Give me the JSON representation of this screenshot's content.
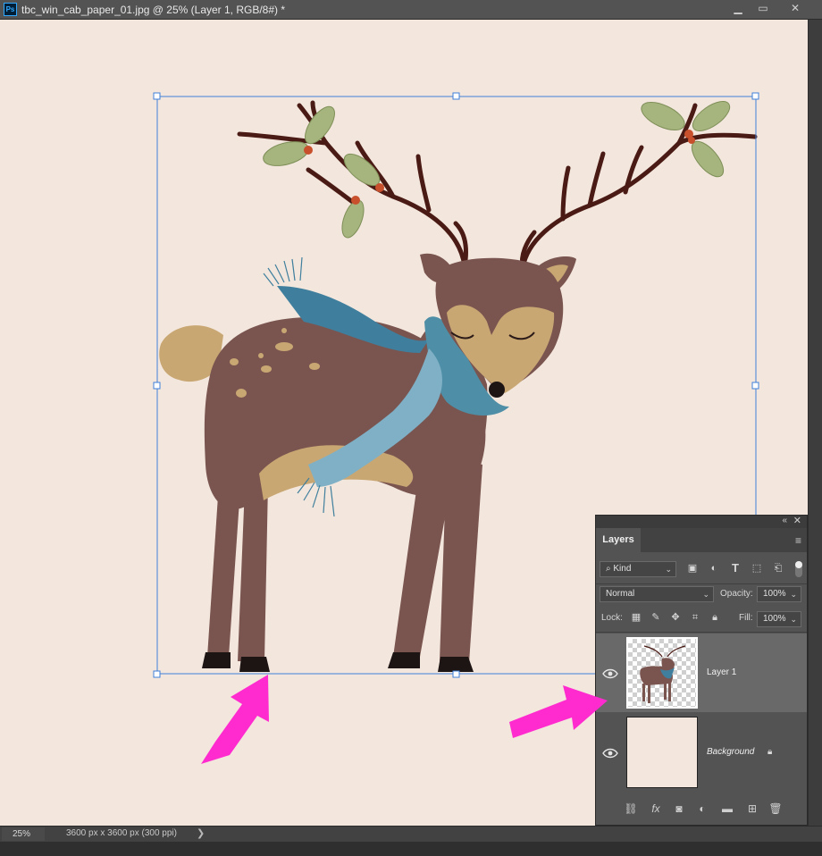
{
  "window": {
    "title": "tbc_win_cab_paper_01.jpg @ 25% (Layer 1, RGB/8#) *",
    "app_icon_text": "Ps",
    "controls": [
      "‹›",
      "▭",
      "✕"
    ]
  },
  "status_bar": {
    "zoom": "25%",
    "doc_size": "3600 px x 3600 px (300 ppi)",
    "arrow": "❯"
  },
  "colors": {
    "canvas_bg": "#f3e7dd",
    "accent_magenta": "#ff2bcf",
    "selection_blue": "#3f7fd8",
    "deer_body": "#7a5550",
    "scarf_blue": "#3f7f9d"
  },
  "layers_panel": {
    "tab_label": "Layers",
    "filter": {
      "label": "Kind",
      "icons": [
        "image-icon",
        "adjustment-icon",
        "type-icon",
        "shape-icon",
        "smart-object-icon"
      ]
    },
    "blend_mode": "Normal",
    "opacity_label": "Opacity:",
    "opacity_value": "100%",
    "lock_label": "Lock:",
    "fill_label": "Fill:",
    "fill_value": "100%",
    "layers": [
      {
        "name": "Layer 1",
        "selected": true,
        "visible": true
      },
      {
        "name": "Background",
        "selected": false,
        "visible": true,
        "locked": true
      }
    ],
    "footer_icons": [
      "link-icon",
      "fx-icon",
      "mask-icon",
      "adjustment-layer-icon",
      "folder-icon",
      "new-layer-icon",
      "trash-icon"
    ]
  }
}
